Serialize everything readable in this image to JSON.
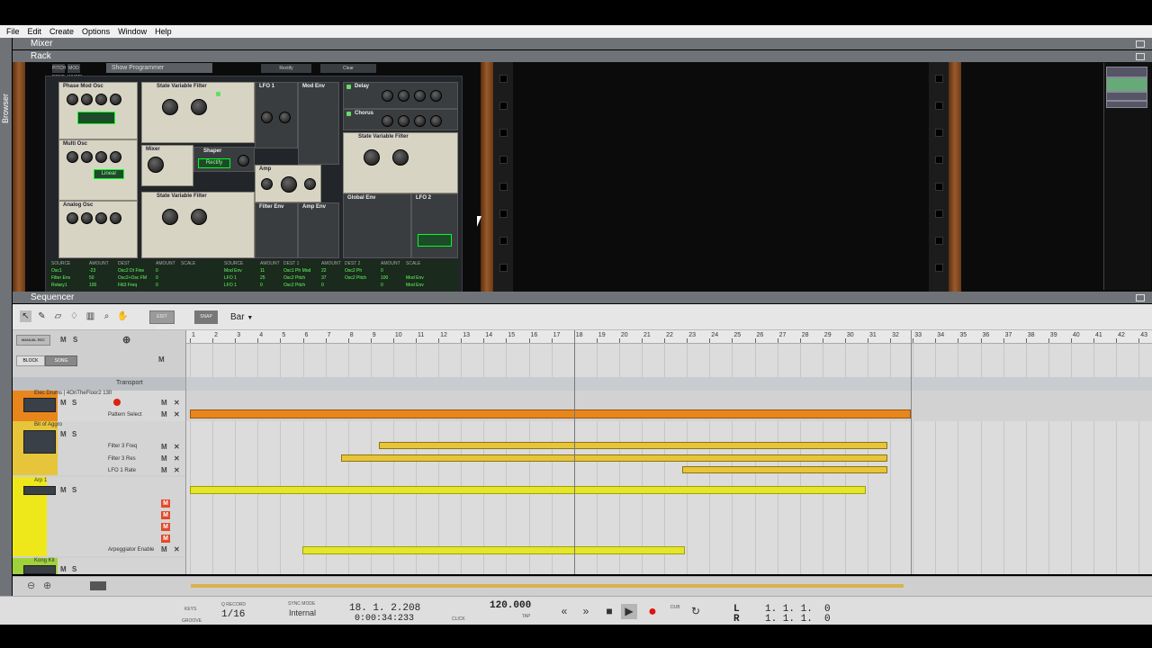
{
  "menu": {
    "items": [
      "File",
      "Edit",
      "Create",
      "Options",
      "Window",
      "Help"
    ]
  },
  "panels": {
    "mixer": "Mixer",
    "rack": "Rack",
    "sequencer": "Sequencer",
    "browser": "Browser"
  },
  "rack": {
    "show_programmer": "Show Programmer",
    "pitch_label": "PITCH BEND",
    "mod_label": "MOD WHEEL",
    "btn_a": "Rectify",
    "btn_b": "Clear",
    "modules": {
      "phase_mod_osc": "Phase Mod Osc",
      "multi_osc": "Multi Osc",
      "analog_osc": "Analog Osc",
      "svf1": "State Variable Filter",
      "svf2": "State Variable Filter",
      "svf3": "State Variable Filter",
      "mixer": "Mixer",
      "shaper": "Shaper",
      "lfo1": "LFO 1",
      "mod_env": "Mod Env",
      "amp": "Amp",
      "filter_env": "Filter Env",
      "amp_env": "Amp Env",
      "delay": "Delay",
      "chorus": "Chorus",
      "global_env": "Global Env",
      "lfo2": "LFO 2",
      "shaper_mode": "Rectify",
      "multi_mode": "Linear"
    },
    "matrix": {
      "headers": [
        "SOURCE",
        "AMOUNT",
        "DEST",
        "AMOUNT",
        "SCALE",
        "SOURCE",
        "AMOUNT",
        "DEST 1",
        "AMOUNT",
        "DEST 2",
        "AMOUNT",
        "SCALE"
      ],
      "rows": [
        [
          "Osc1",
          "-23",
          "Osc2 Dt Fine",
          "0",
          "",
          "Mod Env",
          "11",
          "Osc1 Ph Mod",
          "22",
          "Osc2 Ph",
          "0",
          ""
        ],
        [
          "Filter Env",
          "50",
          "Osc2+Osc FM",
          "0",
          "",
          "LFO 1",
          "25",
          "Osc2 Pitch",
          "37",
          "Osc2 Pitch",
          "100",
          "Mod Env"
        ],
        [
          "Rotary1",
          "100",
          "Filt3 Freq",
          "0",
          "",
          "LFO 1",
          "0",
          "Osc2 Pitch",
          "0",
          "",
          "0",
          "Mod Env"
        ]
      ]
    }
  },
  "toolbar": {
    "edit_mode": "EDIT MODE",
    "snap": "SNAP",
    "snap_value": "Bar"
  },
  "header": {
    "manual_rec": "MANUAL REC",
    "m": "M",
    "s": "S",
    "block": "BLOCK",
    "song": "SONG",
    "m2": "M"
  },
  "ruler": {
    "bars": [
      "1",
      "2",
      "3",
      "4",
      "5",
      "6",
      "7",
      "8",
      "9",
      "10",
      "11",
      "12",
      "13",
      "14",
      "15",
      "16",
      "17",
      "18",
      "19",
      "20",
      "21",
      "22",
      "23",
      "24",
      "25",
      "26",
      "27",
      "28",
      "29",
      "30",
      "31",
      "32",
      "33",
      "34",
      "35",
      "36",
      "37",
      "38",
      "39",
      "40",
      "41",
      "42",
      "43"
    ]
  },
  "tracks": [
    {
      "name": "Transport"
    },
    {
      "name": "Elec Drums | 4OnTheFloor2 130",
      "lane": "Pattern Select"
    },
    {
      "name": "Bit of Aggro",
      "lanes": [
        "Filter 3 Freq",
        "Filter 3 Res",
        "LFO 1 Rate"
      ]
    },
    {
      "name": "Arp 1",
      "lanes": [
        "Arpeggiator Enable"
      ]
    },
    {
      "name": "Kong Kit"
    }
  ],
  "transport": {
    "keys": "KEYS",
    "groove": "GROOVE",
    "q_record": "Q RECORD",
    "quantize": "1/16",
    "sync_mode_label": "SYNC MODE",
    "sync_mode": "Internal",
    "position_bars": "18. 1. 2.208",
    "position_time": "0:00:34:233",
    "click": "CLICK",
    "pre": "PRE",
    "tempo": "120.000",
    "tap": "TAP",
    "dub": "DUB",
    "alt": "ALT",
    "loop_left_label": "L",
    "loop_right_label": "R",
    "loop_left": "1. 1. 1.",
    "loop_left_tick": "0",
    "loop_right": "1. 1. 1.",
    "loop_right_tick": "0"
  },
  "colors": {
    "orange": "#e8861c",
    "yellow": "#e7c53a",
    "lime": "#e5e52a",
    "panel": "#6f7378",
    "wood": "#8a4e22"
  }
}
